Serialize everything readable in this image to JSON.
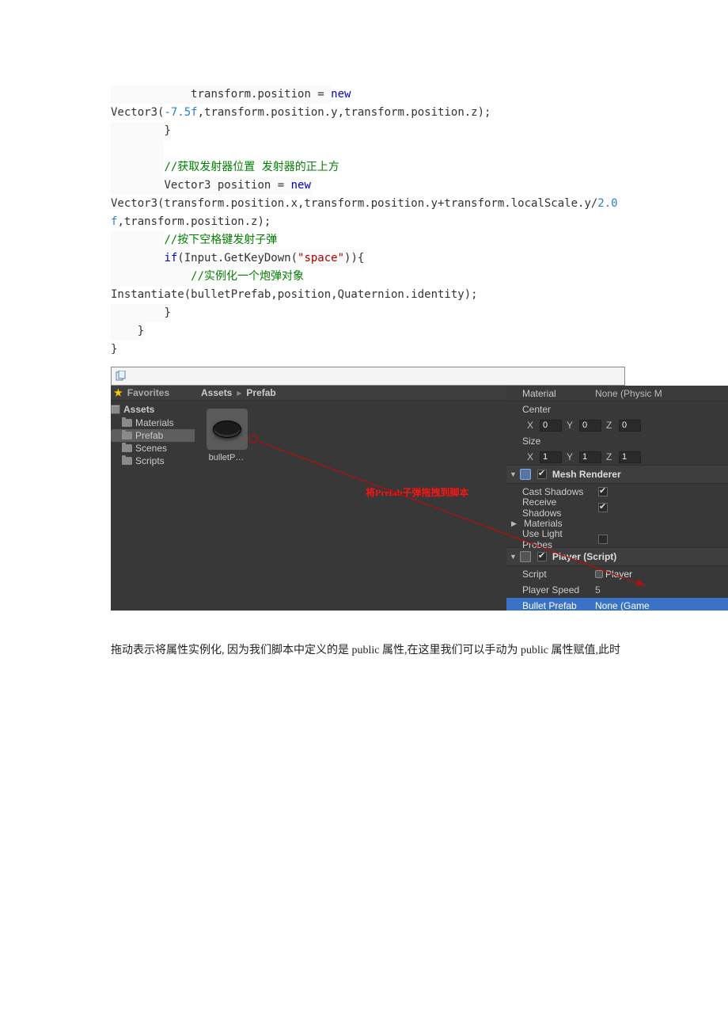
{
  "code": {
    "l1_a": "            transform.position = ",
    "l1_b": "new",
    "l1_c": " ",
    "l2_a": "Vector3(",
    "l2_b": "-7.5f",
    "l2_c": ",transform.position.y,transform.position.z);",
    "l3": "        }",
    "l4": "        ",
    "l5_a": "        ",
    "l5_b": "//获取发射器位置 发射器的正上方",
    "l6_a": "        Vector3 position = ",
    "l6_b": "new",
    "l6_c": " ",
    "l7_a": "Vector3(transform.position.x,transform.position.y+transform.localScale.y/",
    "l7_b": "2.0",
    "l8_a": "f",
    "l8_b": ",transform.position.z);",
    "l9": "",
    "l10_a": "        ",
    "l10_b": "//按下空格键发射子弹",
    "l11_a": "        ",
    "l11_b": "if",
    "l11_c": "(Input.GetKeyDown(",
    "l11_d": "\"space\"",
    "l11_e": ")){",
    "l12_a": "            ",
    "l12_b": "//实例化一个炮弹对象",
    "l13": "Instantiate(bulletPrefab,position,Quaternion.identity);",
    "l14": "        }",
    "l15": "",
    "l16": "    }",
    "l17": "",
    "l18": "}"
  },
  "unity": {
    "favorites": "Favorites",
    "assets": "Assets",
    "tree": {
      "materials": "Materials",
      "prefab": "Prefab",
      "scenes": "Scenes",
      "scripts": "Scripts"
    },
    "breadcrumb": {
      "root": "Assets",
      "folder": "Prefab"
    },
    "item_label": "bulletP…",
    "inspector": {
      "material": "Material",
      "material_val": "None (Physic M",
      "center": "Center",
      "size": "Size",
      "x": "X",
      "y": "Y",
      "z": "Z",
      "center_x": "0",
      "center_y": "0",
      "center_z": "0",
      "size_x": "1",
      "size_y": "1",
      "size_z": "1",
      "mesh_renderer": "Mesh Renderer",
      "cast_shadows": "Cast Shadows",
      "receive_shadows": "Receive Shadows",
      "materials": "Materials",
      "use_light_probes": "Use Light Probes",
      "player_script": "Player (Script)",
      "script": "Script",
      "script_val": "Player",
      "player_speed": "Player Speed",
      "player_speed_val": "5",
      "bullet_prefab": "Bullet Prefab",
      "bullet_prefab_val": "None (Game"
    },
    "annotation": "将Prefab子弹拖拽到脚本 "
  },
  "footer": "拖动表示将属性实例化, 因为我们脚本中定义的是 public 属性,在这里我们可以手动为 public 属性赋值,此时"
}
